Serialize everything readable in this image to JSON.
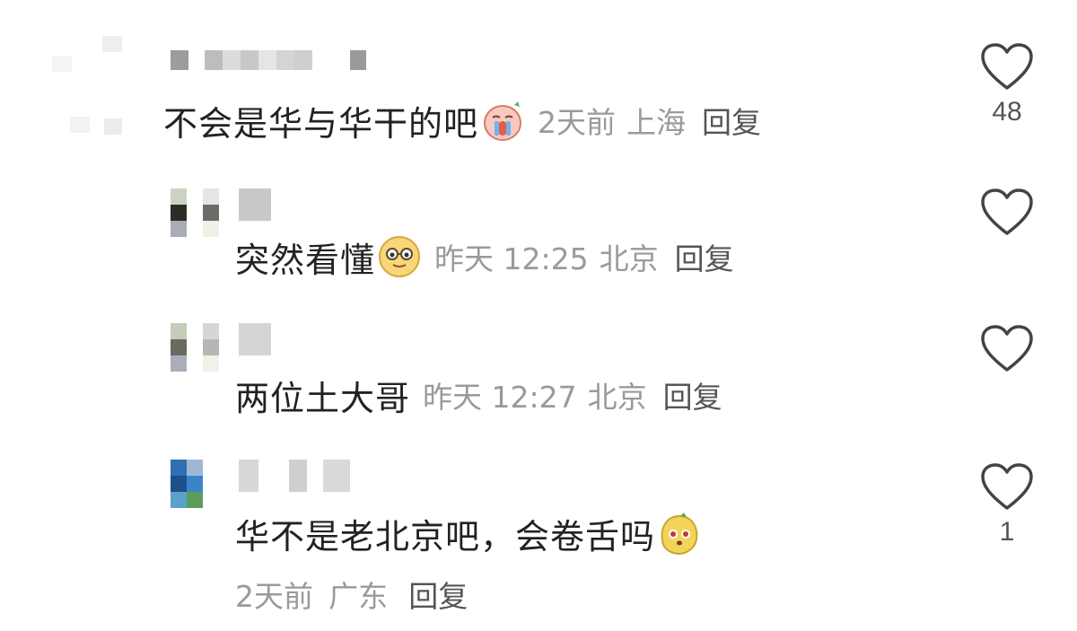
{
  "comments": [
    {
      "text": "不会是华与华干的吧",
      "time": "2天前",
      "location": "上海",
      "reply_label": "回复",
      "likes": "48",
      "emoji": "crying-face-emoji"
    },
    {
      "text": "突然看懂",
      "time": "昨天 12:25",
      "location": "北京",
      "reply_label": "回复",
      "likes": "",
      "emoji": "smug-glasses-emoji"
    },
    {
      "text": "两位土大哥",
      "time": "昨天 12:27",
      "location": "北京",
      "reply_label": "回复",
      "likes": ""
    },
    {
      "text": "华不是老北京吧，会卷舌吗",
      "time": "2天前",
      "location": "广东",
      "reply_label": "回复",
      "likes": "1",
      "emoji": "mango-face-emoji"
    }
  ],
  "colors": {
    "text": "#222222",
    "meta": "#9a9a9a",
    "reply": "#555555",
    "heart_outline": "#444444"
  }
}
